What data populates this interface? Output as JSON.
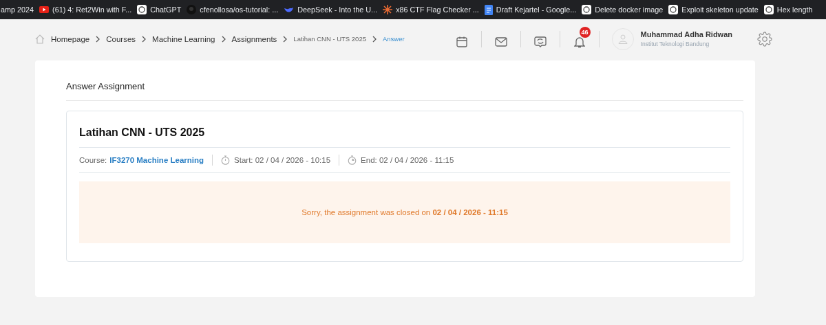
{
  "bookmarks": [
    {
      "label": "amp 2024",
      "kind": "plain"
    },
    {
      "label": "(61) 4: Ret2Win with F...",
      "kind": "video"
    },
    {
      "label": "ChatGPT",
      "kind": "chat"
    },
    {
      "label": "cfenollosa/os-tutorial: ...",
      "kind": "repo"
    },
    {
      "label": "DeepSeek - Into the U...",
      "kind": "whale"
    },
    {
      "label": "x86 CTF Flag Checker ...",
      "kind": "star"
    },
    {
      "label": "Draft Kejartel - Google...",
      "kind": "doc"
    },
    {
      "label": "Delete docker image",
      "kind": "chat"
    },
    {
      "label": "Exploit skeleton update",
      "kind": "chat"
    },
    {
      "label": "Hex length",
      "kind": "chat"
    }
  ],
  "breadcrumbs": [
    {
      "label": "Homepage",
      "kind": "link"
    },
    {
      "label": "Courses",
      "kind": "link"
    },
    {
      "label": "Machine Learning",
      "kind": "link"
    },
    {
      "label": "Assignments",
      "kind": "link"
    },
    {
      "label": "Latihan CNN - UTS 2025",
      "kind": "muted"
    },
    {
      "label": "Answer",
      "kind": "current"
    }
  ],
  "header": {
    "notification_count": "46",
    "user": {
      "name": "Muhammad Adha Ridwan",
      "institution": "Institut Teknologi Bandung"
    }
  },
  "page": {
    "title": "Answer Assignment",
    "assignment": {
      "title": "Latihan CNN - UTS 2025",
      "course_label": "Course:",
      "course": "IF3270 Machine Learning",
      "start": "Start: 02 / 04 / 2026 - 10:15",
      "end": "End: 02 / 04 / 2026 - 11:15",
      "notice": "Sorry, the assignment was closed on **02 / 04 / 2026 - 11:15**"
    }
  }
}
